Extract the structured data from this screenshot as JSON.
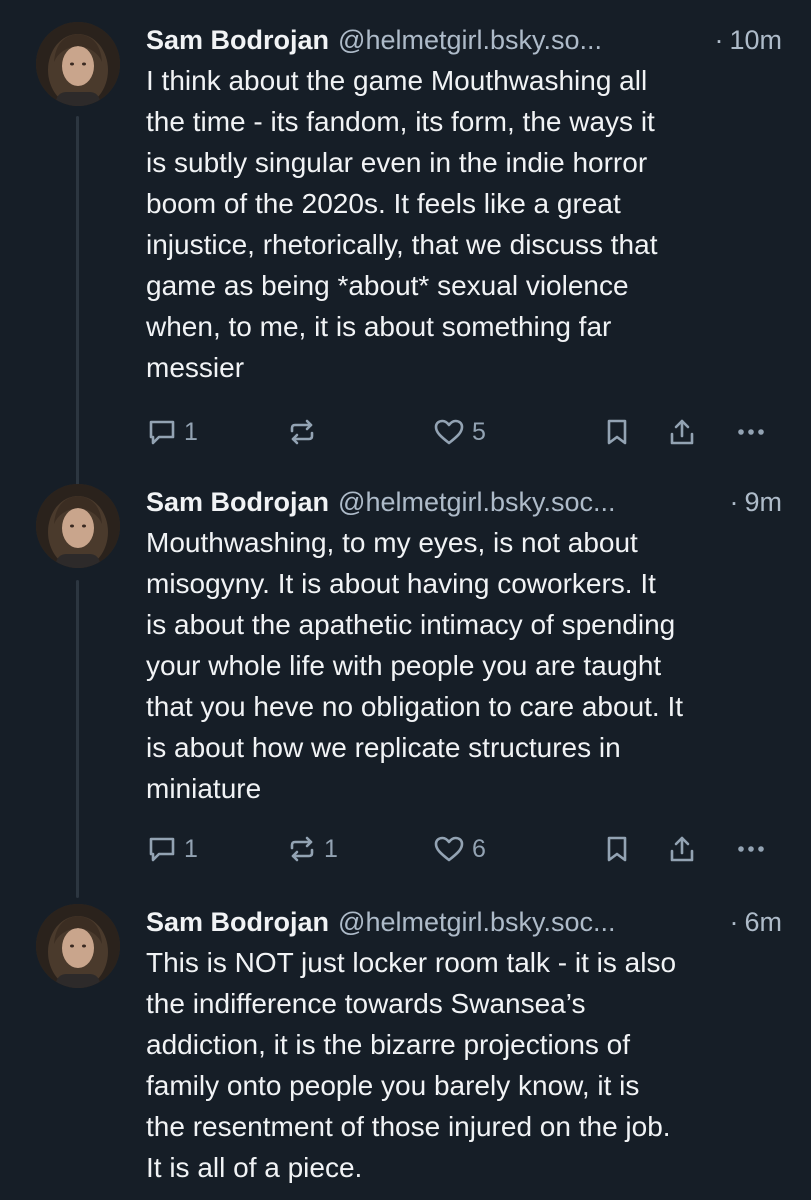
{
  "colors": {
    "background": "#161e27",
    "text": "#f1f3f5",
    "muted": "#aebbc9",
    "icon": "#93a3b3",
    "thread_line": "#2c3640"
  },
  "posts": [
    {
      "author_name": "Sam Bodrojan",
      "handle": "@helmetgirl.bsky.so...",
      "separator": "·",
      "time": "10m",
      "text": "I think about the game Mouthwashing all\nthe time - its fandom, its form, the ways it\nis subtly singular even in the indie horror\nboom of the 2020s. It feels like a great\ninjustice, rhetorically, that we discuss that\ngame as being *about* sexual violence\nwhen, to me, it is about something far\nmessier",
      "reply_count": "1",
      "repost_count": "",
      "like_count": "5"
    },
    {
      "author_name": "Sam Bodrojan",
      "handle": "@helmetgirl.bsky.soc...",
      "separator": "·",
      "time": "9m",
      "text": "Mouthwashing, to my eyes, is not about\nmisogyny. It is about having coworkers. It\nis about the apathetic intimacy of spending\nyour whole life with people you are taught\nthat you heve no obligation to care about. It\nis about how we replicate structures in\nminiature",
      "reply_count": "1",
      "repost_count": "1",
      "like_count": "6"
    },
    {
      "author_name": "Sam Bodrojan",
      "handle": "@helmetgirl.bsky.soc...",
      "separator": "·",
      "time": "6m",
      "text": "This is NOT just locker room talk - it is also\nthe indifference towards Swansea’s\naddiction, it is the bizarre projections of\nfamily onto people you barely know, it is\nthe resentment of those injured on the job.\nIt is all of a piece."
    }
  ],
  "icons": {
    "reply": "reply-icon",
    "repost": "repost-icon",
    "like": "heart-icon",
    "bookmark": "bookmark-icon",
    "share": "share-icon",
    "more": "more-icon"
  }
}
